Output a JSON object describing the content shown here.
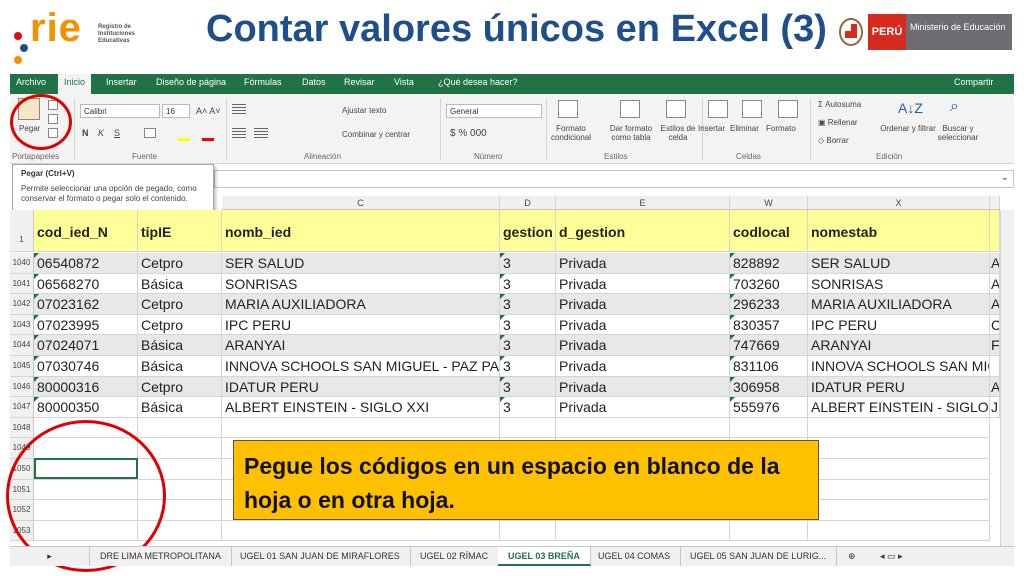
{
  "slide": {
    "title": "Contar valores únicos en Excel (3)",
    "logo_text": "rie",
    "logo_sub": "Registro de Instituciones Educativas",
    "peru": "PERÚ",
    "ministry": "Ministerio de Educación"
  },
  "ribbon_tabs": [
    "Archivo",
    "Inicio",
    "Insertar",
    "Diseño de página",
    "Fórmulas",
    "Datos",
    "Revisar",
    "Vista",
    "¿Qué desea hacer?"
  ],
  "share_label": "Compartir",
  "ribbon": {
    "paste": "Pegar",
    "font_name": "Calibri",
    "font_size": "16",
    "wrap_text": "Ajustar texto",
    "merge_center": "Combinar y centrar",
    "number_format": "General",
    "cond_format": "Formato condicional",
    "format_table": "Dar formato como tabla",
    "cell_styles": "Estilos de celda",
    "insert": "Insertar",
    "delete": "Eliminar",
    "format": "Formato",
    "autosum": "Autosuma",
    "fill": "Rellenar",
    "clear": "Borrar",
    "sort_filter": "Ordenar y filtrar",
    "find_select": "Buscar y seleccionar",
    "groups": [
      "Portapapeles",
      "Fuente",
      "Alineación",
      "Número",
      "Estilos",
      "Celdas",
      "Edición"
    ]
  },
  "tooltip": {
    "title": "Pegar (Ctrl+V)",
    "body": "Permite seleccionar una opción de pegado, como conservar el formato o pegar solo el contenido."
  },
  "columns": [
    "C",
    "D",
    "E",
    "W",
    "X"
  ],
  "headers": [
    "cod_ied_N",
    "tipIE",
    "nomb_ied",
    "gestion",
    "d_gestion",
    "codlocal",
    "nomestab"
  ],
  "header_row_num": "1",
  "rows": [
    {
      "num": "1040",
      "cells": [
        "06540872",
        "Cetpro",
        "SER SALUD",
        "3",
        "Privada",
        "828892",
        "SER SALUD"
      ],
      "next": "A"
    },
    {
      "num": "1041",
      "cells": [
        "06568270",
        "Básica",
        "SONRISAS",
        "3",
        "Privada",
        "703260",
        "SONRISAS"
      ],
      "next": "A"
    },
    {
      "num": "1042",
      "cells": [
        "07023162",
        "Cetpro",
        "MARIA AUXILIADORA",
        "3",
        "Privada",
        "296233",
        "MARIA AUXILIADORA"
      ],
      "next": "A"
    },
    {
      "num": "1043",
      "cells": [
        "07023995",
        "Cetpro",
        "IPC PERU",
        "3",
        "Privada",
        "830357",
        "IPC PERU"
      ],
      "next": "C"
    },
    {
      "num": "1044",
      "cells": [
        "07024071",
        "Básica",
        "ARANYAI",
        "3",
        "Privada",
        "747669",
        "ARANYAI"
      ],
      "next": "F"
    },
    {
      "num": "1045",
      "cells": [
        "07030746",
        "Básica",
        "INNOVA SCHOOLS SAN MIGUEL - PAZ PALMA",
        "3",
        "Privada",
        "831106",
        "INNOVA SCHOOLS SAN MIGUEL"
      ],
      "next": ""
    },
    {
      "num": "1046",
      "cells": [
        "80000316",
        "Cetpro",
        "IDATUR PERU",
        "3",
        "Privada",
        "306958",
        "IDATUR PERU"
      ],
      "next": "A"
    },
    {
      "num": "1047",
      "cells": [
        "80000350",
        "Básica",
        "ALBERT EINSTEIN - SIGLO XXI",
        "3",
        "Privada",
        "555976",
        "ALBERT EINSTEIN - SIGLO XXI"
      ],
      "next": "J"
    }
  ],
  "empty_rows": [
    "1048",
    "1049",
    "1050",
    "1051",
    "1052",
    "1053"
  ],
  "callout": "Pegue los códigos en un espacio en blanco de la hoja o en otra hoja.",
  "sheet_tabs": [
    "DRE LIMA METROPOLITANA",
    "UGEL 01 SAN JUAN DE MIRAFLORES",
    "UGEL 02 RÍMAC",
    "UGEL 03 BREÑA",
    "UGEL 04 COMAS",
    "UGEL 05 SAN JUAN DE LURIG..."
  ],
  "active_sheet_index": 3,
  "colors": {
    "excel_green": "#217346",
    "header_yellow": "#ffff99",
    "callout": "#ffc000",
    "highlight_circle": "#e00000",
    "title_blue": "#1f4e8c"
  }
}
